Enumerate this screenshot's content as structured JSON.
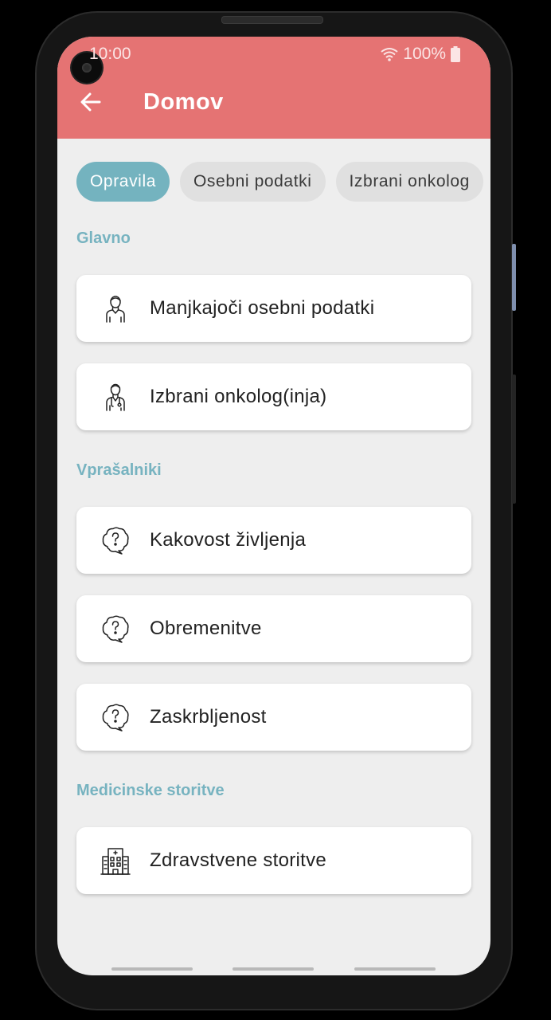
{
  "status": {
    "time": "10:00",
    "battery": "100%"
  },
  "appbar": {
    "title": "Domov"
  },
  "chips": [
    "Opravila",
    "Osebni podatki",
    "Izbrani onkolog"
  ],
  "sections": {
    "glavno": "Glavno",
    "vprasalniki": "Vprašalniki",
    "medicinske": "Medicinske storitve"
  },
  "items": [
    {
      "label": "Manjkajoči osebni podatki",
      "icon": "person-icon"
    },
    {
      "label": "Izbrani onkolog(inja)",
      "icon": "doctor-icon"
    },
    {
      "label": "Kakovost življenja",
      "icon": "question-bubble-icon"
    },
    {
      "label": "Obremenitve",
      "icon": "question-bubble-icon"
    },
    {
      "label": "Zaskrbljenost",
      "icon": "question-bubble-icon"
    },
    {
      "label": "Zdravstvene storitve",
      "icon": "hospital-icon"
    }
  ],
  "colors": {
    "appbar": "#e57373",
    "accent": "#74b3bf",
    "section": "#77b3c0",
    "background": "#eeeeee"
  }
}
